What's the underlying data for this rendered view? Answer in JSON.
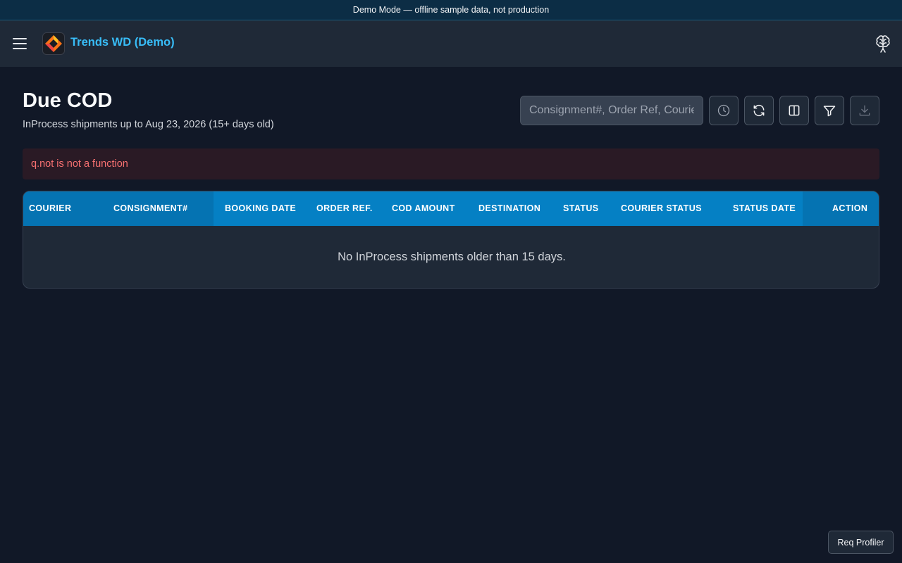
{
  "banner": {
    "text": "Demo Mode — offline sample data, not production"
  },
  "header": {
    "brand": "Trends WD (Demo)",
    "icons": [
      "hamburger-menu-icon",
      "brand-logo",
      "brain-icon"
    ],
    "brand_color": "#38bdf8"
  },
  "page": {
    "title": "Due COD",
    "subtitle": "InProcess shipments up to Aug 23, 2026 (15+ days old)"
  },
  "search": {
    "placeholder": "Consignment#, Order Ref, Courier"
  },
  "toolbar": {
    "icons": [
      "history-clock-icon",
      "refresh-icon",
      "columns-icon",
      "filter-icon",
      "download-icon"
    ]
  },
  "error": {
    "message": "q.not is not a function",
    "color": "#f87171"
  },
  "table": {
    "header_color": "#0580c4",
    "columns": [
      "COURIER",
      "CONSIGNMENT#",
      "BOOKING DATE",
      "ORDER REF.",
      "COD AMOUNT",
      "DESTINATION",
      "STATUS",
      "COURIER STATUS",
      "STATUS DATE",
      "ACTION"
    ],
    "rows": [],
    "empty_message": "No InProcess shipments older than 15 days."
  },
  "footer": {
    "profiler_label": "Req Profiler"
  }
}
